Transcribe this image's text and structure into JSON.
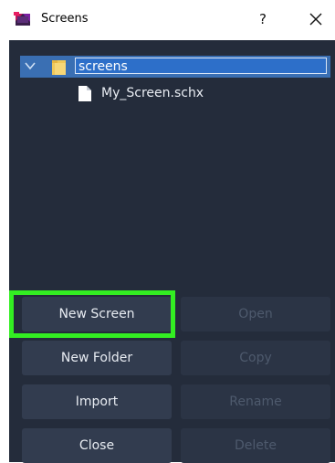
{
  "window": {
    "title": "Screens",
    "help_label": "?"
  },
  "tree": {
    "root_label": "screens",
    "file_label": "My_Screen.schx"
  },
  "buttons": {
    "new_screen": "New Screen",
    "open": "Open",
    "new_folder": "New Folder",
    "copy": "Copy",
    "import": "Import",
    "rename": "Rename",
    "close": "Close",
    "delete": "Delete"
  },
  "colors": {
    "panel_background": "#242c3b",
    "selection": "#3a6fb3",
    "button": "#323c4f",
    "highlight_outline": "#33ee22"
  }
}
